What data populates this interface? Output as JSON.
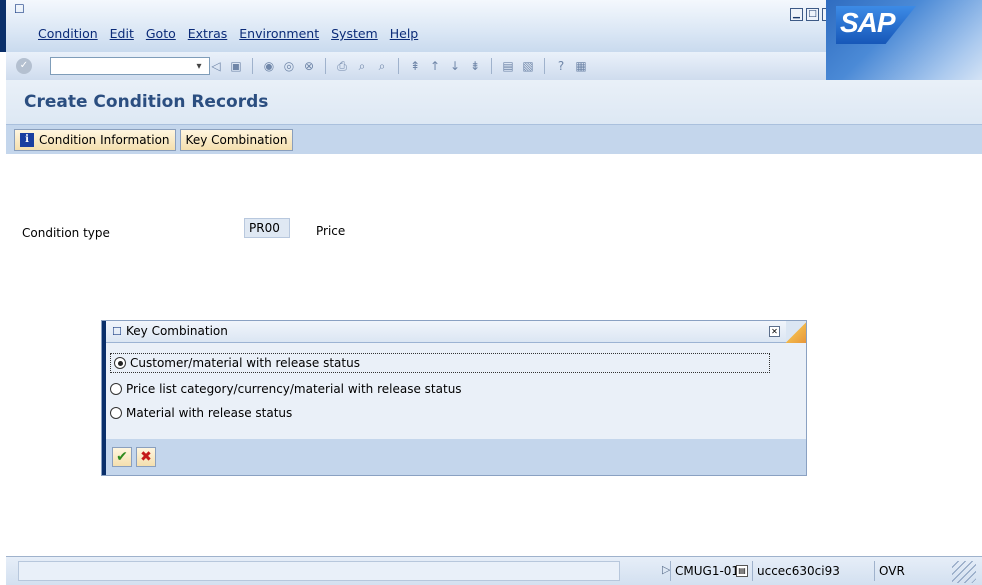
{
  "window": {
    "icon": "window-menu-icon",
    "controls": [
      "minimize-icon",
      "maximize-icon",
      "close-icon"
    ],
    "brand": "SAP"
  },
  "menubar": [
    "Condition",
    "Edit",
    "Goto",
    "Extras",
    "Environment",
    "System",
    "Help"
  ],
  "toolbar": {
    "command_field_value": "",
    "icons": [
      "back-icon",
      "save-icon",
      "back-arrow-icon",
      "exit-icon",
      "cancel-icon",
      "print-icon",
      "find-icon",
      "find-next-icon",
      "first-page-icon",
      "previous-page-icon",
      "next-page-icon",
      "last-page-icon",
      "create-session-icon",
      "shortcut-icon",
      "help-icon",
      "layout-icon"
    ]
  },
  "page": {
    "title": "Create Condition Records"
  },
  "app_toolbar": {
    "condition_info_label": "Condition Information",
    "key_combination_label": "Key Combination"
  },
  "main": {
    "condition_type_label": "Condition type",
    "condition_type_value": "PR00",
    "condition_type_desc": "Price"
  },
  "dialog": {
    "title": "Key Combination",
    "options": [
      {
        "label": "Customer/material with release status",
        "selected": true
      },
      {
        "label": "Price list category/currency/material with release status",
        "selected": false
      },
      {
        "label": "Material with release status",
        "selected": false
      }
    ],
    "buttons": [
      "continue-icon",
      "cancel-icon"
    ]
  },
  "statusbar": {
    "system": "CMUG1-011",
    "host": "uccec630ci93",
    "mode": "OVR"
  }
}
